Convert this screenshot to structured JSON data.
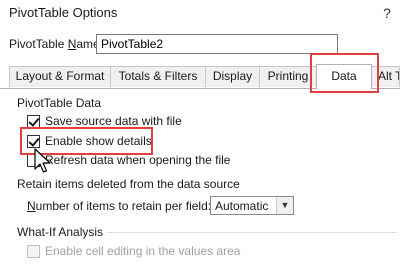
{
  "window": {
    "title": "PivotTable Options",
    "help": "?"
  },
  "name_field": {
    "label_prefix": "PivotTable ",
    "label_hotkey": "N",
    "label_suffix": "ame:",
    "value": "PivotTable2"
  },
  "tabs": [
    {
      "label": "Layout & Format",
      "active": false
    },
    {
      "label": "Totals & Filters",
      "active": false
    },
    {
      "label": "Display",
      "active": false
    },
    {
      "label": "Printing",
      "active": false
    },
    {
      "label": "Data",
      "active": true
    },
    {
      "label": "Alt T",
      "active": false
    }
  ],
  "data_section": {
    "title": "PivotTable Data",
    "options": [
      {
        "label": "Save source data with file",
        "checked": true
      },
      {
        "label": "Enable show details",
        "checked": true
      },
      {
        "label": "Refresh data when opening the file",
        "checked": false
      }
    ]
  },
  "retain_section": {
    "title": "Retain items deleted from the data source",
    "label_hotkey": "N",
    "label_rest": "umber of items to retain per field:",
    "selected": "Automatic"
  },
  "whatif_section": {
    "title": "What-If Analysis",
    "option": {
      "label": "Enable cell editing in the values area",
      "checked": false,
      "disabled": true
    }
  },
  "colors": {
    "highlight": "#e04040",
    "disabled_text": "#a0a0a0"
  },
  "icons": {
    "cursor": "pointer-cursor-icon",
    "dropdown": "chevron-down-icon"
  }
}
